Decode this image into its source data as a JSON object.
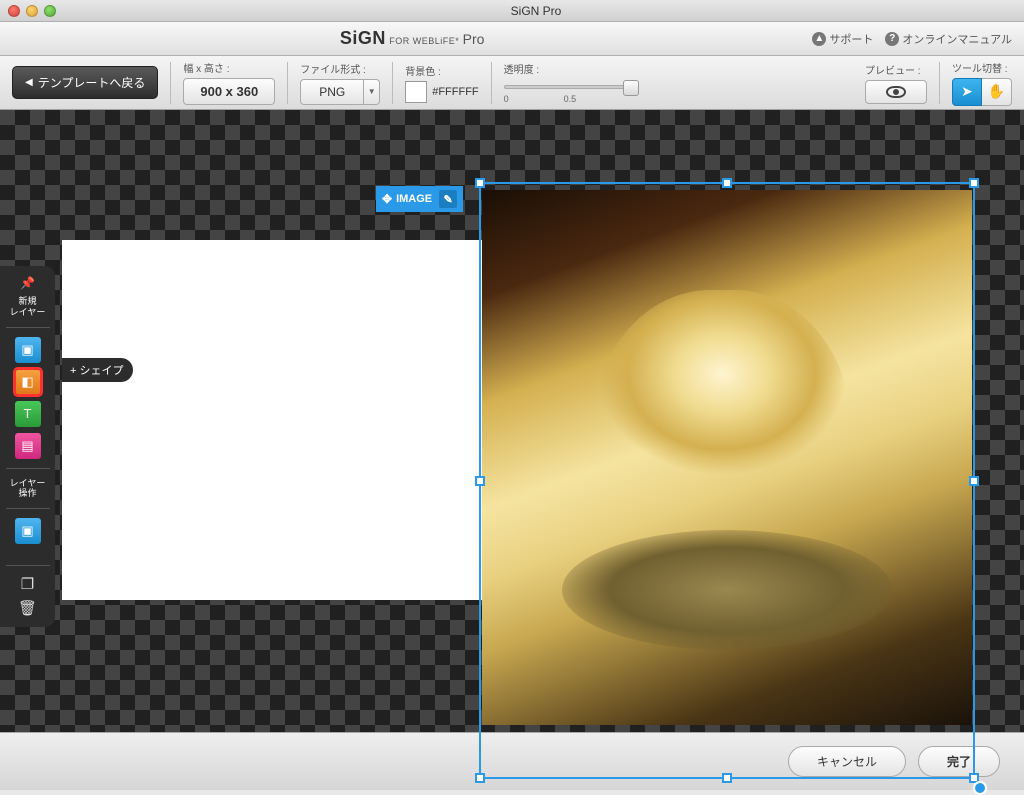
{
  "window": {
    "title": "SiGN Pro"
  },
  "header": {
    "brand_main": "SiGN",
    "brand_sub": "FOR WEBLiFE*",
    "brand_suffix": "Pro",
    "support_label": "サポート",
    "manual_label": "オンラインマニュアル"
  },
  "toolbar": {
    "back_label": "テンプレートへ戻る",
    "dim_label": "幅 x 高さ :",
    "dim_value": "900 x 360",
    "format_label": "ファイル形式 :",
    "format_value": "PNG",
    "bg_label": "背景色 :",
    "bg_value": "#FFFFFF",
    "opacity_label": "透明度 :",
    "opacity_min": "0",
    "opacity_mid": "0.5",
    "preview_label": "プレビュー :",
    "tool_label": "ツール切替 :"
  },
  "selection": {
    "tag": "IMAGE"
  },
  "sidepanel": {
    "new_label": "新規\nレイヤー",
    "ops_label": "レイヤー\n操作",
    "shape_flyout": "+ シェイプ",
    "text_glyph": "T"
  },
  "footer": {
    "cancel": "キャンセル",
    "done": "完了"
  }
}
